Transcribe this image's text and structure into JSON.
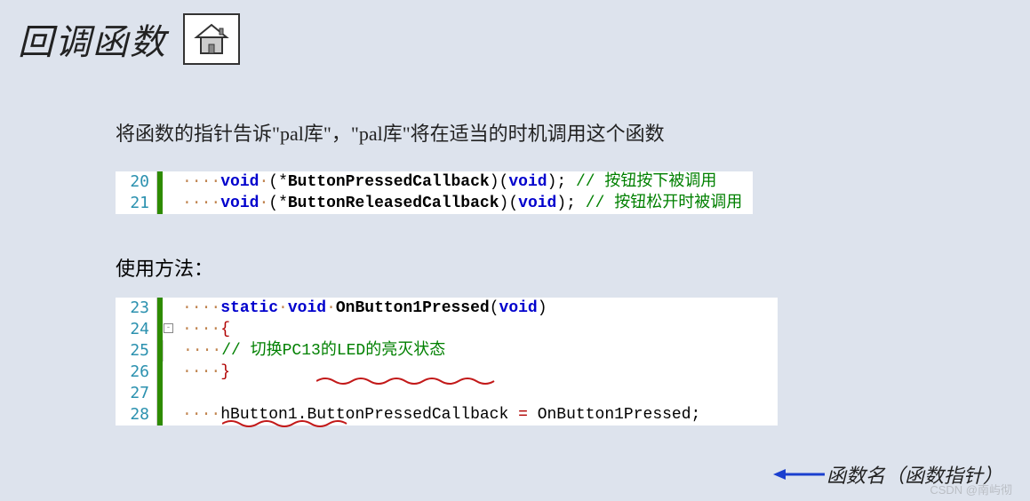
{
  "title": "回调函数",
  "desc": "将函数的指针告诉\"pal库\"，\"pal库\"将在适当的时机调用这个函数",
  "code1": {
    "lines": [
      {
        "num": "20",
        "kw1": "void",
        "spc": " ",
        "lp": "(",
        "star": "*",
        "name": "ButtonPressedCallback",
        "rp": ")",
        "lp2": "(",
        "arg": "void",
        "rp2": ")",
        "semi": ";",
        "cmt": " // 按钮按下被调用"
      },
      {
        "num": "21",
        "kw1": "void",
        "spc": " ",
        "lp": "(",
        "star": "*",
        "name": "ButtonReleasedCallback",
        "rp": ")",
        "lp2": "(",
        "arg": "void",
        "rp2": ")",
        "semi": ";",
        "cmt": " // 按钮松开时被调用"
      }
    ]
  },
  "subtitle": "使用方法：",
  "code2": {
    "l23": {
      "num": "23",
      "kw_static": "static",
      "kw_void1": "void",
      "name": "OnButton1Pressed",
      "lp": "(",
      "kw_void2": "void",
      "rp": ")"
    },
    "l24": {
      "num": "24",
      "brace": "{"
    },
    "l25": {
      "num": "25",
      "cmt": "// 切换PC13的LED的亮灭状态"
    },
    "l26": {
      "num": "26",
      "brace": "}"
    },
    "l27": {
      "num": "27"
    },
    "l28": {
      "num": "28",
      "obj": "hButton1",
      "dot": ".",
      "member": "ButtonPressedCallback",
      "eq": " = ",
      "fn": "OnButton1Pressed",
      "semi": ";"
    }
  },
  "annotation": "函数名（函数指针）",
  "watermark": "CSDN @南屿彻"
}
